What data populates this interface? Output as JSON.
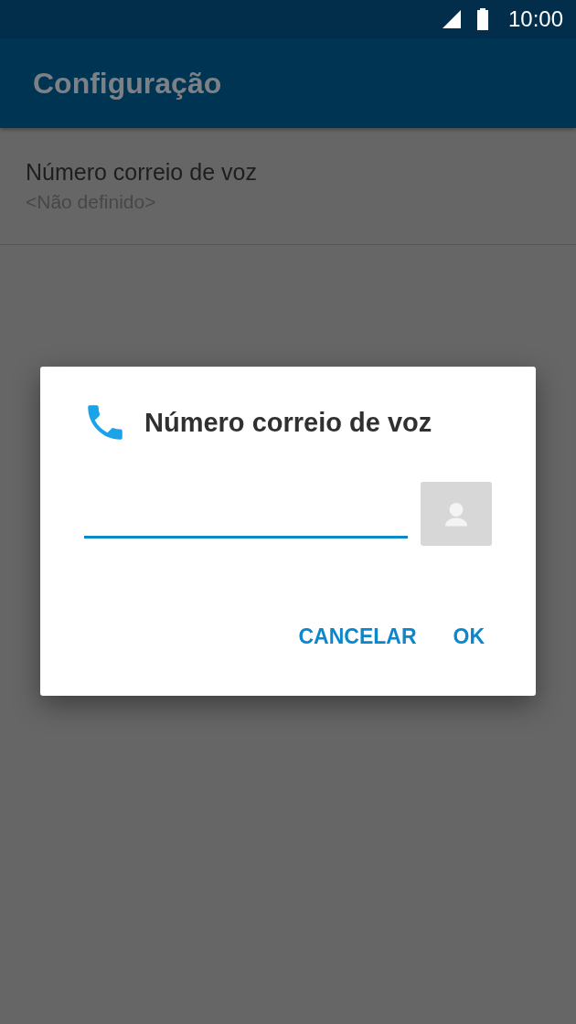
{
  "status_bar": {
    "time": "10:00"
  },
  "app_bar": {
    "title": "Configuração"
  },
  "settings": [
    {
      "title": "Número correio de voz",
      "summary": "<Não definido>"
    }
  ],
  "dialog": {
    "title": "Número correio de voz",
    "field": {
      "focused": true
    },
    "buttons": [
      "CANCELAR",
      "OK"
    ]
  }
}
